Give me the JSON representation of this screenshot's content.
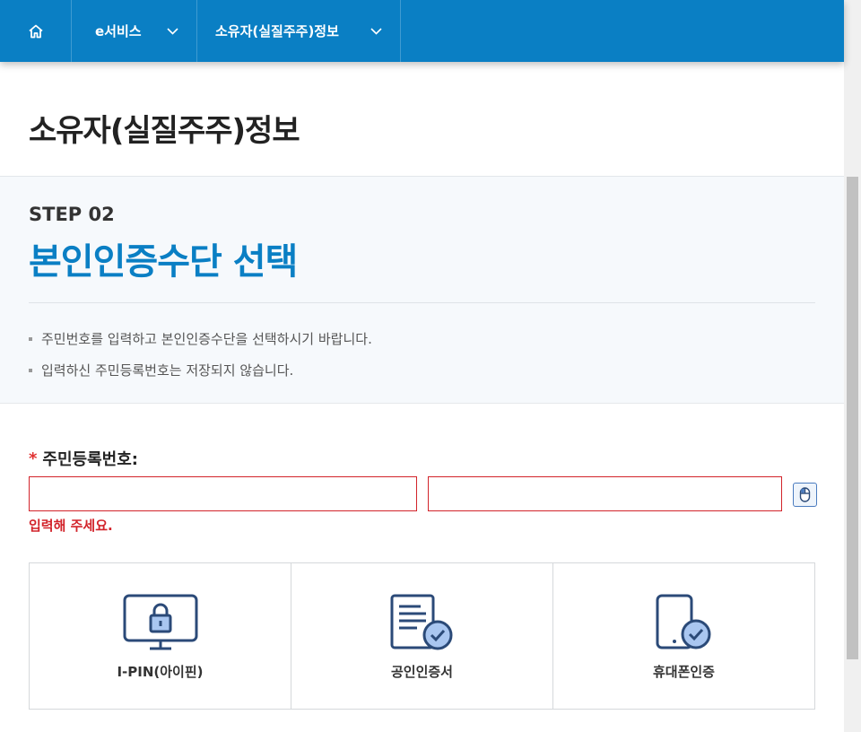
{
  "nav": {
    "home_icon": "home-icon",
    "items": [
      {
        "label": "e서비스"
      },
      {
        "label": "소유자(실질주주)정보"
      }
    ]
  },
  "page": {
    "title": "소유자(실질주주)정보"
  },
  "step": {
    "label": "STEP 02",
    "heading": "본인인증수단 선택",
    "notices": [
      "주민번호를 입력하고 본인인증수단을 선택하시기 바랍니다.",
      "입력하신 주민등록번호는 저장되지 않습니다."
    ]
  },
  "form": {
    "required_mark": "*",
    "ssn_label": "주민등록번호:",
    "ssn_first_value": "",
    "ssn_second_value": "",
    "error": "입력해 주세요."
  },
  "auth_options": [
    {
      "label": "I-PIN(아이핀)",
      "icon": "ipin-monitor-lock-icon"
    },
    {
      "label": "공인인증서",
      "icon": "certificate-icon"
    },
    {
      "label": "휴대폰인증",
      "icon": "mobile-phone-check-icon"
    }
  ],
  "colors": {
    "brand": "#0a7fc4",
    "error": "#d2232a",
    "icon_stroke": "#2b4a78",
    "icon_fill": "#a9c6f0"
  }
}
